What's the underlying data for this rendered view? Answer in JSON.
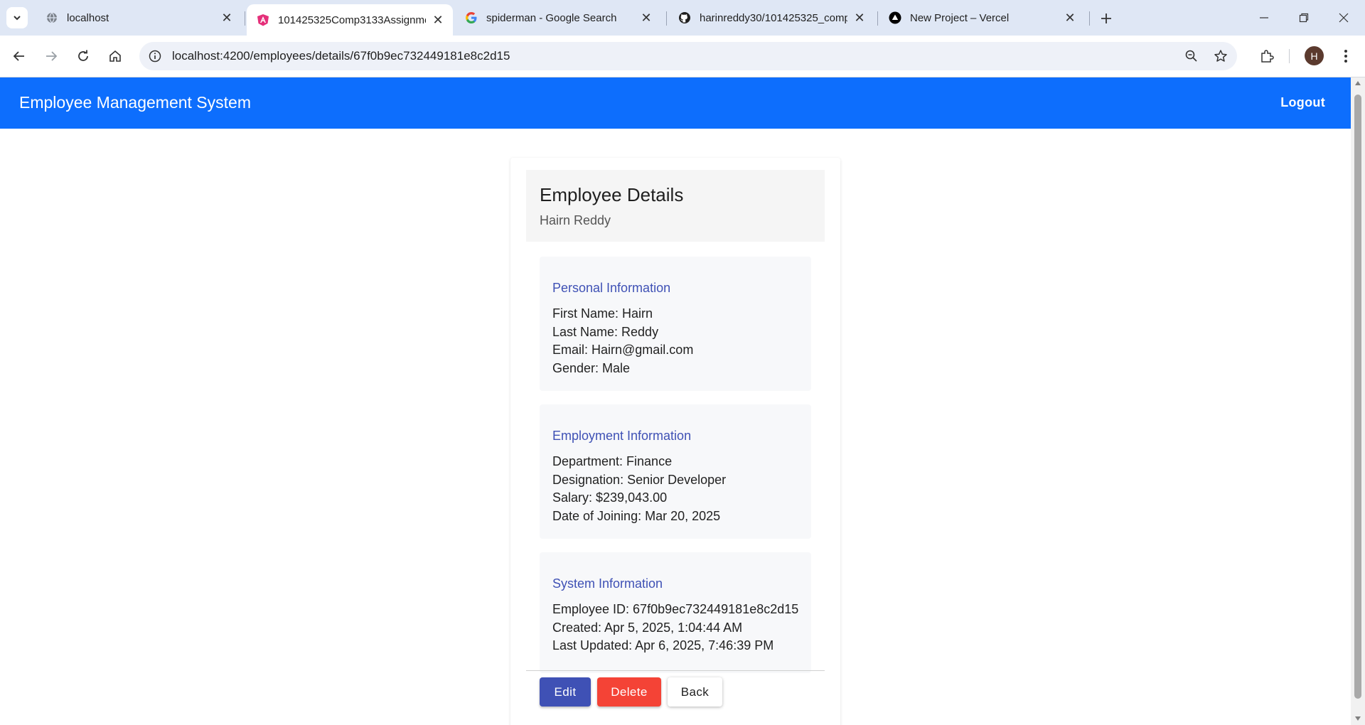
{
  "browser": {
    "tabs": [
      {
        "title": "localhost",
        "icon": "globe-icon",
        "active": false
      },
      {
        "title": "101425325Comp3133Assignme",
        "icon": "angular-icon",
        "active": true
      },
      {
        "title": "spiderman - Google Search",
        "icon": "google-icon",
        "active": false
      },
      {
        "title": "harinreddy30/101425325_comp",
        "icon": "github-icon",
        "active": false
      },
      {
        "title": "New Project – Vercel",
        "icon": "vercel-icon",
        "active": false
      }
    ],
    "url": "localhost:4200/employees/details/67f0b9ec732449181e8c2d15",
    "profile_initial": "H"
  },
  "navbar": {
    "brand": "Employee Management System",
    "logout_label": "Logout",
    "color": "#0d6efd"
  },
  "details": {
    "title": "Employee Details",
    "subtitle": "Hairn Reddy",
    "sections": [
      {
        "title": "Personal Information",
        "rows": [
          "First Name: Hairn",
          "Last Name: Reddy",
          "Email: Hairn@gmail.com",
          "Gender: Male"
        ]
      },
      {
        "title": "Employment Information",
        "rows": [
          "Department: Finance",
          "Designation: Senior Developer",
          "Salary: $239,043.00",
          "Date of Joining: Mar 20, 2025"
        ]
      },
      {
        "title": "System Information",
        "rows": [
          "Employee ID: 67f0b9ec732449181e8c2d15",
          "Created: Apr 5, 2025, 1:04:44 AM",
          "Last Updated: Apr 6, 2025, 7:46:39 PM"
        ]
      }
    ],
    "actions": {
      "edit_label": "Edit",
      "delete_label": "Delete",
      "back_label": "Back"
    }
  },
  "colors": {
    "primary": "#3f51b5",
    "danger": "#f44336",
    "section_title": "#3f51b5"
  }
}
